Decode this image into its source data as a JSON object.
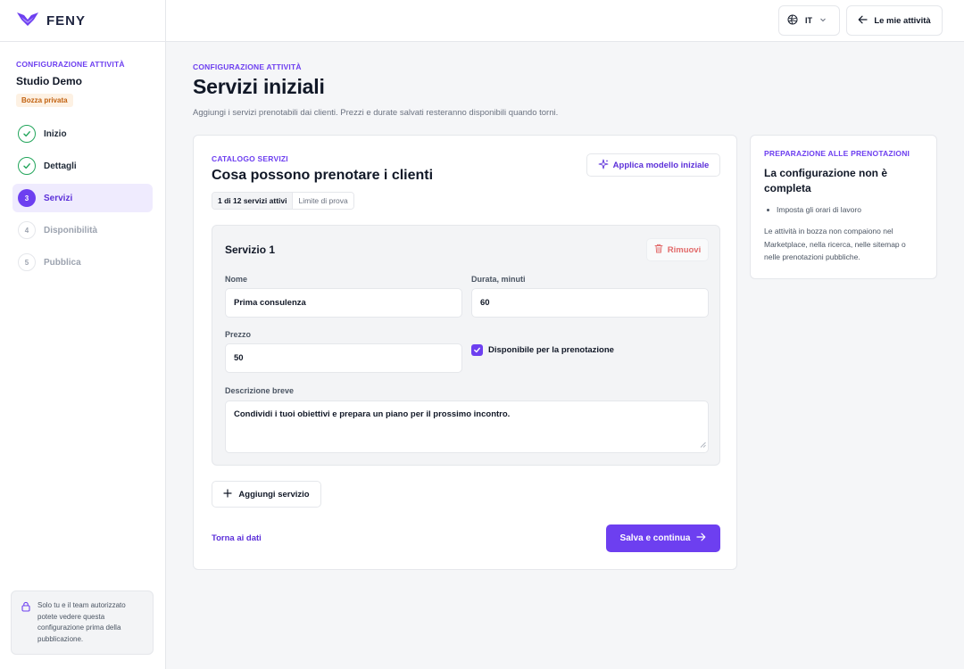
{
  "brand": {
    "name": "FENY"
  },
  "sidebar": {
    "eyebrow": "CONFIGURAZIONE ATTIVITÀ",
    "studio_name": "Studio Demo",
    "status_badge": "Bozza privata",
    "steps": [
      {
        "number": "1",
        "label": "Inizio",
        "state": "done"
      },
      {
        "number": "2",
        "label": "Dettagli",
        "state": "done"
      },
      {
        "number": "3",
        "label": "Servizi",
        "state": "current"
      },
      {
        "number": "4",
        "label": "Disponibilità",
        "state": "todo"
      },
      {
        "number": "5",
        "label": "Pubblica",
        "state": "todo"
      }
    ],
    "privacy_note": "Solo tu e il team autorizzato potete vedere questa configurazione prima della pubblicazione."
  },
  "topbar": {
    "language": "IT",
    "back_label": "Le mie attività"
  },
  "header": {
    "eyebrow": "CONFIGURAZIONE ATTIVITÀ",
    "title": "Servizi iniziali",
    "subtitle": "Aggiungi i servizi prenotabili dai clienti. Prezzi e durate salvati resteranno disponibili quando torni."
  },
  "catalog": {
    "eyebrow": "CATALOGO SERVIZI",
    "title": "Cosa possono prenotare i clienti",
    "usage_count": "1 di 12 servizi attivi",
    "usage_limit": "Limite di prova",
    "template_label": "Applica modello iniziale",
    "service": {
      "title": "Servizio 1",
      "remove_label": "Rimuovi",
      "name_label": "Nome",
      "name_value": "Prima consulenza",
      "duration_label": "Durata, minuti",
      "duration_value": "60",
      "price_label": "Prezzo",
      "price_value": "50",
      "available_label": "Disponibile per la prenotazione",
      "available_checked": true,
      "description_label": "Descrizione breve",
      "description_value": "Condividi i tuoi obiettivi e prepara un piano per il prossimo incontro."
    },
    "add_label": "Aggiungi servizio",
    "back_link": "Torna ai dati",
    "save_label": "Salva e continua"
  },
  "panel": {
    "eyebrow": "PREPARAZIONE ALLE PRENOTAZIONI",
    "title": "La configurazione non è completa",
    "items": [
      "Imposta gli orari di lavoro"
    ],
    "note": "Le attività in bozza non compaiono nel Marketplace, nella ricerca, nelle sitemap o nelle prenotazioni pubbliche."
  },
  "colors": {
    "accent": "#6d3ff0",
    "success": "#22a55b",
    "danger": "#e26a6a",
    "draft": "#c26210"
  }
}
